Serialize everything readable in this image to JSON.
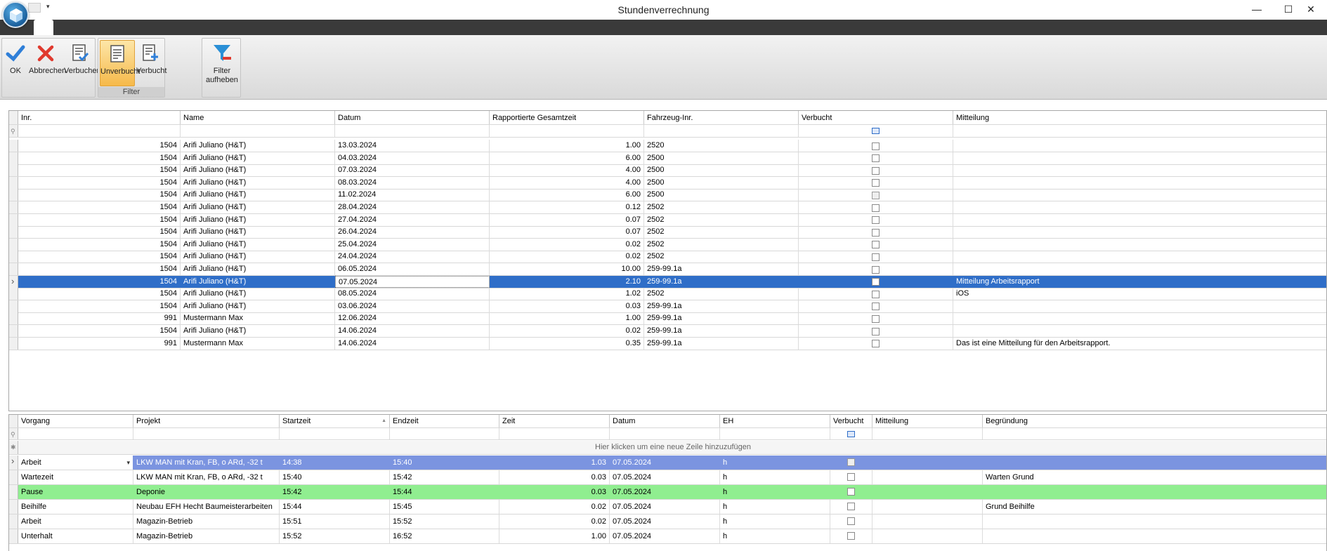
{
  "window": {
    "title": "Stundenverrechnung",
    "minimize": "—",
    "maximize": "☐",
    "close": "✕",
    "qat_dropdown": "▾"
  },
  "ribbon": {
    "ok": "OK",
    "cancel": "Abbrechen",
    "book": "Verbuchen",
    "unbooked": "Unverbucht",
    "booked": "Verbucht",
    "filter_clear_1": "Filter",
    "filter_clear_2": "aufheben",
    "filter_group_label": "Filter"
  },
  "grid1": {
    "columns": [
      "Inr.",
      "Name",
      "Datum",
      "Rapportierte Gesamtzeit",
      "Fahrzeug-Inr.",
      "Verbucht",
      "Mitteilung"
    ],
    "rows": [
      {
        "inr": "1504",
        "name": "Arifi Juliano (H&T)",
        "datum": "13.03.2024",
        "zeit": "1.00",
        "fz": "2520",
        "msg": ""
      },
      {
        "inr": "1504",
        "name": "Arifi Juliano (H&T)",
        "datum": "04.03.2024",
        "zeit": "6.00",
        "fz": "2500",
        "msg": ""
      },
      {
        "inr": "1504",
        "name": "Arifi Juliano (H&T)",
        "datum": "07.03.2024",
        "zeit": "4.00",
        "fz": "2500",
        "msg": ""
      },
      {
        "inr": "1504",
        "name": "Arifi Juliano (H&T)",
        "datum": "08.03.2024",
        "zeit": "4.00",
        "fz": "2500",
        "msg": ""
      },
      {
        "inr": "1504",
        "name": "Arifi Juliano (H&T)",
        "datum": "11.02.2024",
        "zeit": "6.00",
        "fz": "2500",
        "msg": ""
      },
      {
        "inr": "1504",
        "name": "Arifi Juliano (H&T)",
        "datum": "28.04.2024",
        "zeit": "0.12",
        "fz": "2502",
        "msg": ""
      },
      {
        "inr": "1504",
        "name": "Arifi Juliano (H&T)",
        "datum": "27.04.2024",
        "zeit": "0.07",
        "fz": "2502",
        "msg": ""
      },
      {
        "inr": "1504",
        "name": "Arifi Juliano (H&T)",
        "datum": "26.04.2024",
        "zeit": "0.07",
        "fz": "2502",
        "msg": ""
      },
      {
        "inr": "1504",
        "name": "Arifi Juliano (H&T)",
        "datum": "25.04.2024",
        "zeit": "0.02",
        "fz": "2502",
        "msg": ""
      },
      {
        "inr": "1504",
        "name": "Arifi Juliano (H&T)",
        "datum": "24.04.2024",
        "zeit": "0.02",
        "fz": "2502",
        "msg": ""
      },
      {
        "inr": "1504",
        "name": "Arifi Juliano (H&T)",
        "datum": "06.05.2024",
        "zeit": "10.00",
        "fz": "259-99.1a",
        "msg": ""
      },
      {
        "inr": "1504",
        "name": "Arifi Juliano (H&T)",
        "datum": "07.05.2024",
        "zeit": "2.10",
        "fz": "259-99.1a",
        "msg": "Mitteilung Arbeitsrapport"
      },
      {
        "inr": "1504",
        "name": "Arifi Juliano (H&T)",
        "datum": "08.05.2024",
        "zeit": "1.02",
        "fz": "2502",
        "msg": "iOS"
      },
      {
        "inr": "1504",
        "name": "Arifi Juliano (H&T)",
        "datum": "03.06.2024",
        "zeit": "0.03",
        "fz": "259-99.1a",
        "msg": ""
      },
      {
        "inr": "991",
        "name": "Mustermann Max",
        "datum": "12.06.2024",
        "zeit": "1.00",
        "fz": "259-99.1a",
        "msg": ""
      },
      {
        "inr": "1504",
        "name": "Arifi Juliano (H&T)",
        "datum": "14.06.2024",
        "zeit": "0.02",
        "fz": "259-99.1a",
        "msg": ""
      },
      {
        "inr": "991",
        "name": "Mustermann Max",
        "datum": "14.06.2024",
        "zeit": "0.35",
        "fz": "259-99.1a",
        "msg": "Das ist eine Mitteilung für den Arbeitsrapport."
      }
    ]
  },
  "grid2": {
    "columns": [
      "Vorgang",
      "Projekt",
      "Startzeit",
      "Endzeit",
      "Zeit",
      "Datum",
      "EH",
      "Verbucht",
      "Mitteilung",
      "Begründung"
    ],
    "new_row_hint": "Hier klicken um eine neue Zeile hinzuzufügen",
    "rows": [
      {
        "vorgang": "Arbeit",
        "projekt": "LKW MAN mit Kran, FB, o ARd, -32 t",
        "start": "14:38",
        "end": "15:40",
        "zeit": "1.03",
        "datum": "07.05.2024",
        "eh": "h",
        "msg": "",
        "grund": ""
      },
      {
        "vorgang": "Wartezeit",
        "projekt": "LKW MAN mit Kran, FB, o ARd, -32 t",
        "start": "15:40",
        "end": "15:42",
        "zeit": "0.03",
        "datum": "07.05.2024",
        "eh": "h",
        "msg": "",
        "grund": "Warten Grund"
      },
      {
        "vorgang": "Pause",
        "projekt": "Deponie",
        "start": "15:42",
        "end": "15:44",
        "zeit": "0.03",
        "datum": "07.05.2024",
        "eh": "h",
        "msg": "",
        "grund": ""
      },
      {
        "vorgang": "Beihilfe",
        "projekt": "Neubau EFH Hecht Baumeisterarbeiten",
        "start": "15:44",
        "end": "15:45",
        "zeit": "0.02",
        "datum": "07.05.2024",
        "eh": "h",
        "msg": "",
        "grund": "Grund Beihilfe"
      },
      {
        "vorgang": "Arbeit",
        "projekt": "Magazin-Betrieb",
        "start": "15:51",
        "end": "15:52",
        "zeit": "0.02",
        "datum": "07.05.2024",
        "eh": "h",
        "msg": "",
        "grund": ""
      },
      {
        "vorgang": "Unterhalt",
        "projekt": "Magazin-Betrieb",
        "start": "15:52",
        "end": "16:52",
        "zeit": "1.00",
        "datum": "07.05.2024",
        "eh": "h",
        "msg": "",
        "grund": ""
      }
    ]
  }
}
